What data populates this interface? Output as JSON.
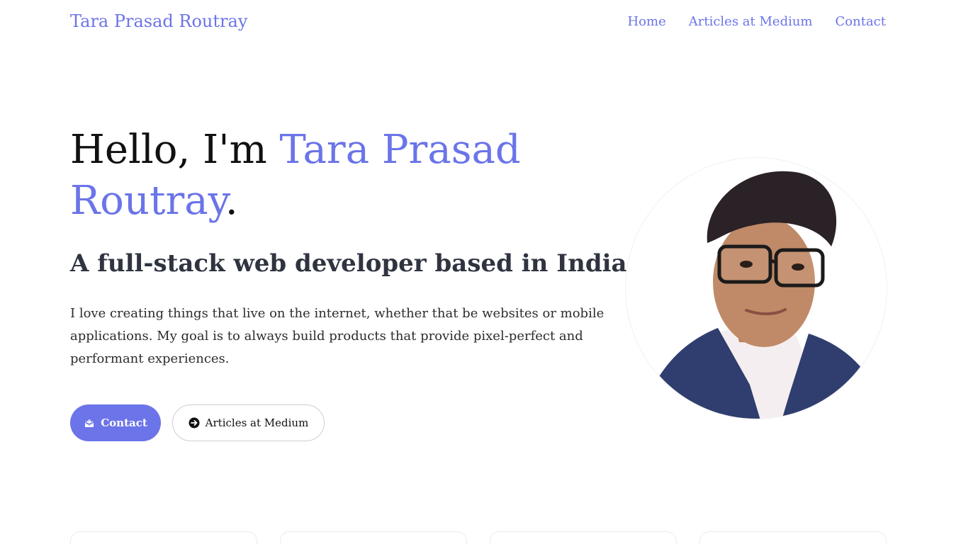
{
  "nav": {
    "brand": "Tara Prasad Routray",
    "links": [
      {
        "label": "Home"
      },
      {
        "label": "Articles at Medium"
      },
      {
        "label": "Contact"
      }
    ]
  },
  "hero": {
    "title_prefix": "Hello, I'm ",
    "title_name": "Tara Prasad Routray",
    "title_suffix": ".",
    "subtitle": "A full-stack web developer based in India.",
    "description": "I love creating things that live on the internet, whether that be websites or mobile applications. My goal is to always build products that provide pixel-perfect and performant experiences.",
    "primary_button": {
      "label": "Contact",
      "icon": "envelope-open-icon"
    },
    "secondary_button": {
      "label": "Articles at Medium",
      "icon": "arrow-right-circle-icon"
    }
  },
  "profile_photo": {
    "kind": "portrait-photo"
  },
  "colors": {
    "accent": "#6b74e8",
    "text": "#111111",
    "subtitle": "#2f3440"
  }
}
